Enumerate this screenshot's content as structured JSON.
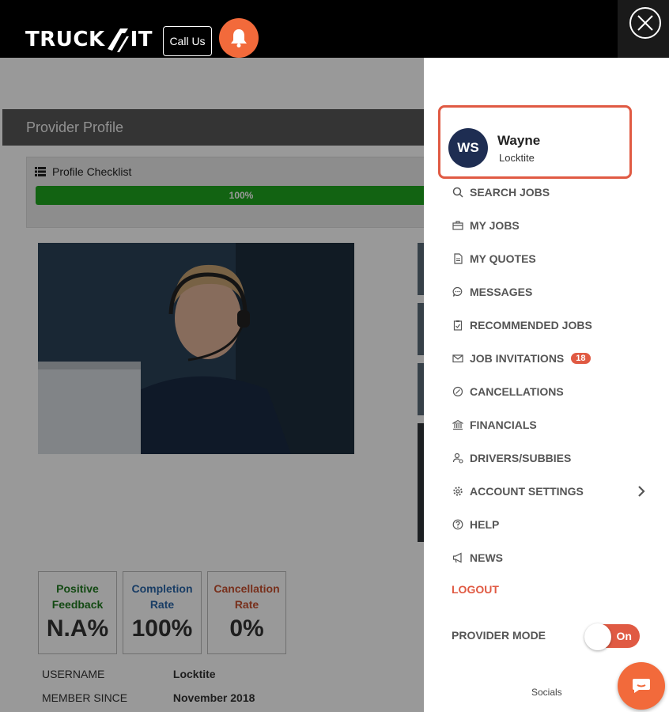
{
  "header": {
    "logo_text_left": "TRUCK",
    "logo_text_right": "IT",
    "call_label": "Call Us"
  },
  "page": {
    "title": "Provider Profile",
    "checklist_title": "Profile Checklist",
    "progress_percent": 100,
    "progress_label": "100%",
    "stats": [
      {
        "label_line1": "Positive",
        "label_line2": "Feedback",
        "value": "N.A%",
        "color": "#1f7a1f"
      },
      {
        "label_line1": "Completion",
        "label_line2": "Rate",
        "value": "100%",
        "color": "#2a66a8"
      },
      {
        "label_line1": "Cancellation",
        "label_line2": "Rate",
        "value": "0%",
        "color": "#c8502f"
      }
    ],
    "info": [
      {
        "key": "USERNAME",
        "value": "Locktite"
      },
      {
        "key": "MEMBER SINCE",
        "value": "November 2018"
      }
    ]
  },
  "drawer": {
    "user": {
      "initials": "WS",
      "name": "Wayne",
      "company": "Locktite"
    },
    "menu": [
      {
        "label": "SEARCH JOBS",
        "icon": "search-icon"
      },
      {
        "label": "MY JOBS",
        "icon": "briefcase-icon"
      },
      {
        "label": "MY QUOTES",
        "icon": "document-icon"
      },
      {
        "label": "MESSAGES",
        "icon": "chat-bubble-icon"
      },
      {
        "label": "RECOMMENDED JOBS",
        "icon": "clipboard-check-icon"
      },
      {
        "label": "JOB INVITATIONS",
        "icon": "envelope-icon",
        "badge": "18"
      },
      {
        "label": "CANCELLATIONS",
        "icon": "cancel-circle-icon"
      },
      {
        "label": "FINANCIALS",
        "icon": "bank-icon"
      },
      {
        "label": "DRIVERS/SUBBIES",
        "icon": "driver-icon"
      },
      {
        "label": "ACCOUNT SETTINGS",
        "icon": "gear-icon"
      },
      {
        "label": "HELP",
        "icon": "help-circle-icon"
      },
      {
        "label": "NEWS",
        "icon": "megaphone-icon"
      }
    ],
    "logout_label": "LOGOUT",
    "provider_mode_label": "PROVIDER MODE",
    "provider_mode_state": "On",
    "socials_label": "Socials"
  },
  "colors": {
    "accent": "#e05a43",
    "brand_orange": "#f26a3b",
    "progress_green": "#1fa51f",
    "avatar_navy": "#1e2d52"
  }
}
